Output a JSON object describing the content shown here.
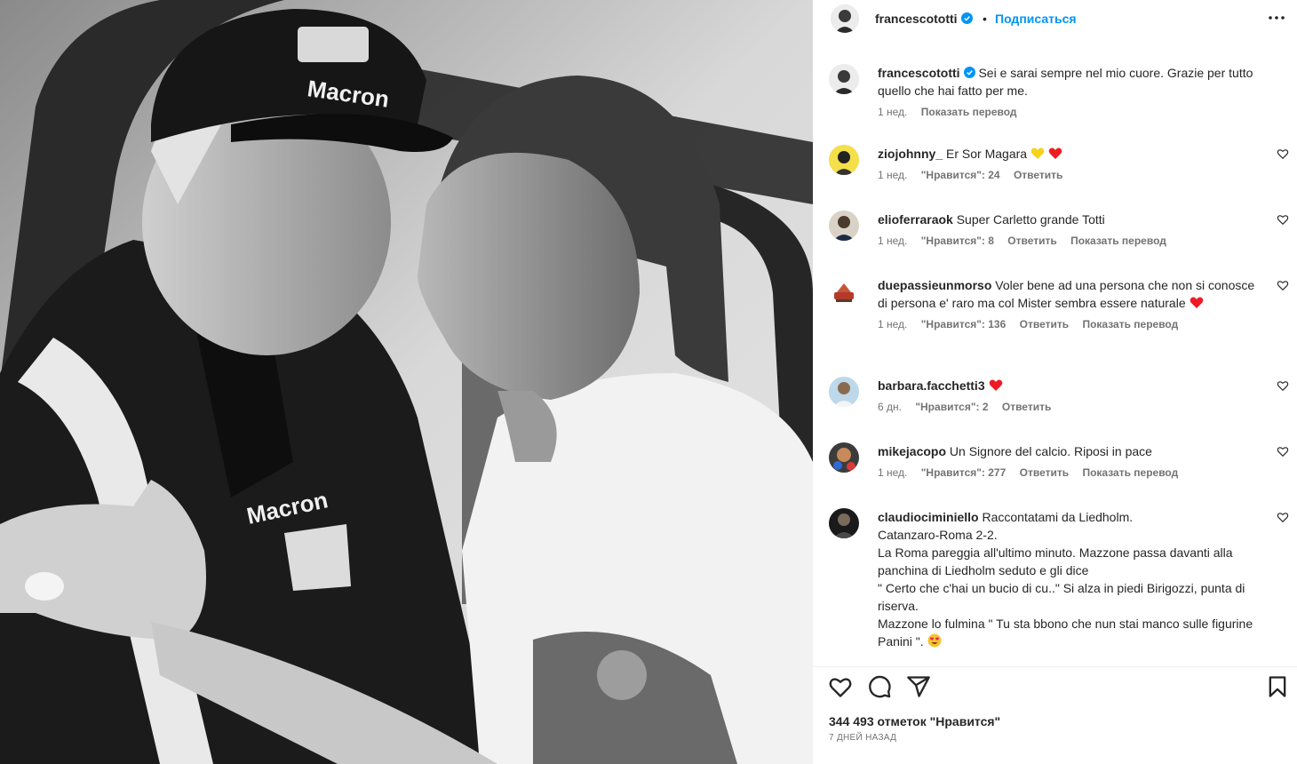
{
  "post": {
    "username": "francescototti",
    "follow_label": "Подписаться",
    "separator": "•",
    "caption": "Sei e sarai sempre nel mio cuore. Grazie per tutto quello che hai fatto per me.",
    "caption_time": "1 нед.",
    "caption_translate": "Показать перевод",
    "photo_text": {
      "cap_logo": "Macron",
      "jacket_logo": "Macron"
    }
  },
  "comments": [
    {
      "user": "ziojohnny_",
      "text": "Er Sor Magara",
      "hearts": [
        "yellow",
        "red"
      ],
      "time": "1 нед.",
      "likes": "\"Нравится\": 24",
      "reply": "Ответить",
      "translate": ""
    },
    {
      "user": "elioferraraok",
      "text": "Super Carletto grande Totti",
      "hearts": [],
      "time": "1 нед.",
      "likes": "\"Нравится\": 8",
      "reply": "Ответить",
      "translate": "Показать перевод"
    },
    {
      "user": "duepassieunmorso",
      "text": "Voler bene ad una persona che non si conosce di persona e' raro ma col Mister sembra essere naturale",
      "hearts": [
        "red"
      ],
      "time": "1 нед.",
      "likes": "\"Нравится\": 136",
      "reply": "Ответить",
      "translate": "Показать перевод"
    },
    {
      "user": "barbara.facchetti3",
      "text": "",
      "hearts": [
        "red"
      ],
      "time": "6 дн.",
      "likes": "\"Нравится\": 2",
      "reply": "Ответить",
      "translate": ""
    },
    {
      "user": "mikejacopo",
      "text": "Un Signore del calcio. Riposi in pace",
      "hearts": [],
      "time": "1 нед.",
      "likes": "\"Нравится\": 277",
      "reply": "Ответить",
      "translate": "Показать перевод"
    },
    {
      "user": "claudiociminiello",
      "text": "Raccontatami da Liedholm.",
      "lines": [
        "Catanzaro-Roma 2-2.",
        "La Roma pareggia all'ultimo minuto. Mazzone passa davanti alla panchina di Liedholm seduto e gli dice",
        "\" Certo che c'hai un bucio di cu..\" Si alza in piedi Birigozzi, punta di riserva.",
        "Mazzone lo fulmina \" Tu sta bbono che nun stai manco sulle figurine Panini \"."
      ],
      "hearts": [],
      "time": "",
      "likes": "",
      "reply": "",
      "translate": ""
    }
  ],
  "footer": {
    "likes": "344 493 отметок \"Нравится\"",
    "date": "7 ДНЕЙ НАЗАД"
  },
  "colors": {
    "accent": "#0095f6",
    "heart_red": "#ed1c24",
    "heart_yellow": "#f5d31b",
    "verified": "#0095f6"
  },
  "icons": [
    "more-icon",
    "like-icon",
    "comment-icon",
    "share-icon",
    "save-icon",
    "verified-icon"
  ]
}
